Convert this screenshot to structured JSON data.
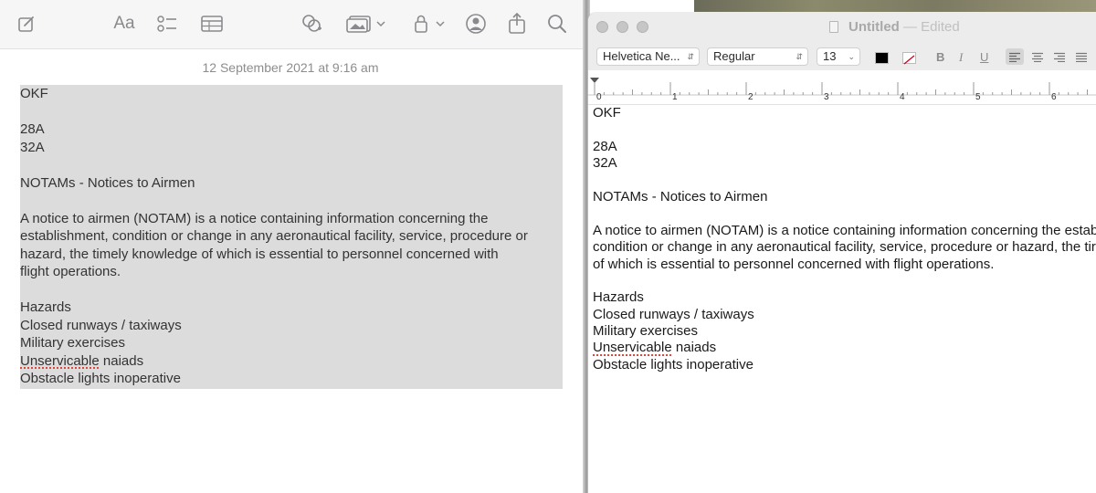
{
  "notes": {
    "toolbar": {
      "icons": [
        "compose-icon",
        "format-text-icon",
        "checklist-icon",
        "table-icon",
        "collaborate-icon",
        "media-icon",
        "lock-icon",
        "share-people-icon",
        "share-icon",
        "search-icon"
      ],
      "format_label": "Aa"
    },
    "date": "12 September 2021 at 9:16 am",
    "lines": {
      "l1": "OKF",
      "l2": "28A",
      "l3": "32A",
      "l4": "NOTAMs - Notices to Airmen",
      "p1": "A notice to airmen (NOTAM) is a notice containing information concerning the",
      "p2": "establishment, condition or change in any aeronautical facility, service, procedure or",
      "p3": "hazard, the timely knowledge of which is essential to personnel concerned with",
      "p4": "flight operations.",
      "h1": "Hazards",
      "h2": "Closed runways / taxiways",
      "h3": "Military exercises",
      "h4a": "Unservicable",
      "h4b": " naiads",
      "h5": "Obstacle lights inoperative"
    },
    "selection_color": "#dcdcdc"
  },
  "textedit": {
    "title": "Untitled",
    "title_sep": " — ",
    "status": "Edited",
    "format_bar": {
      "font_family": "Helvetica Ne...",
      "font_style": "Regular",
      "font_size": "13",
      "bold": "B",
      "italic": "I",
      "underline": "U",
      "text_color": "#000000"
    },
    "ruler": {
      "numbers": [
        "0",
        "1",
        "2",
        "3",
        "4",
        "5",
        "6"
      ]
    },
    "lines": {
      "l1": "OKF",
      "l2": "28A",
      "l3": "32A",
      "l4": "NOTAMs - Notices to Airmen",
      "p1": "A notice to airmen (NOTAM) is a notice containing information concerning the establ",
      "p2": "condition or change in any aeronautical facility, service, procedure or hazard, the tir",
      "p3": "of which is essential to personnel concerned with flight operations.",
      "h1": "Hazards",
      "h2": "Closed runways / taxiways",
      "h3": "Military exercises",
      "h4a": "Unservicable",
      "h4b": " naiads",
      "h5": "Obstacle lights inoperative"
    }
  }
}
